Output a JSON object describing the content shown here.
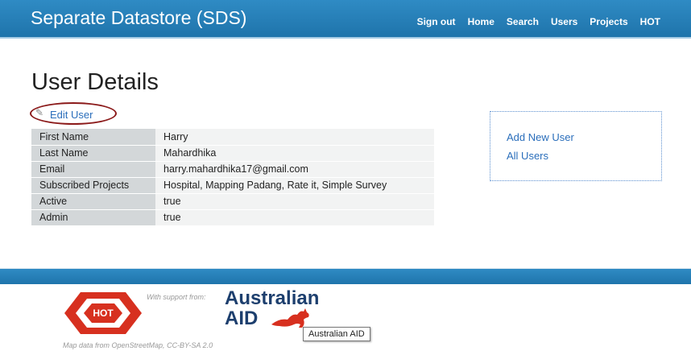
{
  "header": {
    "brand": "Separate Datastore (SDS)",
    "nav": [
      "Sign out",
      "Home",
      "Search",
      "Users",
      "Projects",
      "HOT"
    ]
  },
  "main": {
    "title": "User Details",
    "edit_link": "Edit User",
    "details": [
      {
        "label": "First Name",
        "value": "Harry"
      },
      {
        "label": "Last Name",
        "value": "Mahardhika"
      },
      {
        "label": "Email",
        "value": "harry.mahardhika17@gmail.com"
      },
      {
        "label": "Subscribed Projects",
        "value": "Hospital, Mapping Padang, Rate it, Simple Survey"
      },
      {
        "label": "Active",
        "value": "true"
      },
      {
        "label": "Admin",
        "value": "true"
      }
    ]
  },
  "sidebar": {
    "links": [
      "Add New User",
      "All Users"
    ]
  },
  "footer": {
    "hot_logo": "HOT",
    "support_text": "With support from:",
    "aus_line1": "Australian",
    "aus_line2": "AID",
    "tooltip": "Australian AID",
    "credit": "Map data from OpenStreetMap, CC-BY-SA 2.0"
  },
  "colors": {
    "header": "#1f74ab",
    "link": "#2a6ebb",
    "highlight_ring": "#8b1a1a",
    "hot_red": "#d7301f"
  }
}
